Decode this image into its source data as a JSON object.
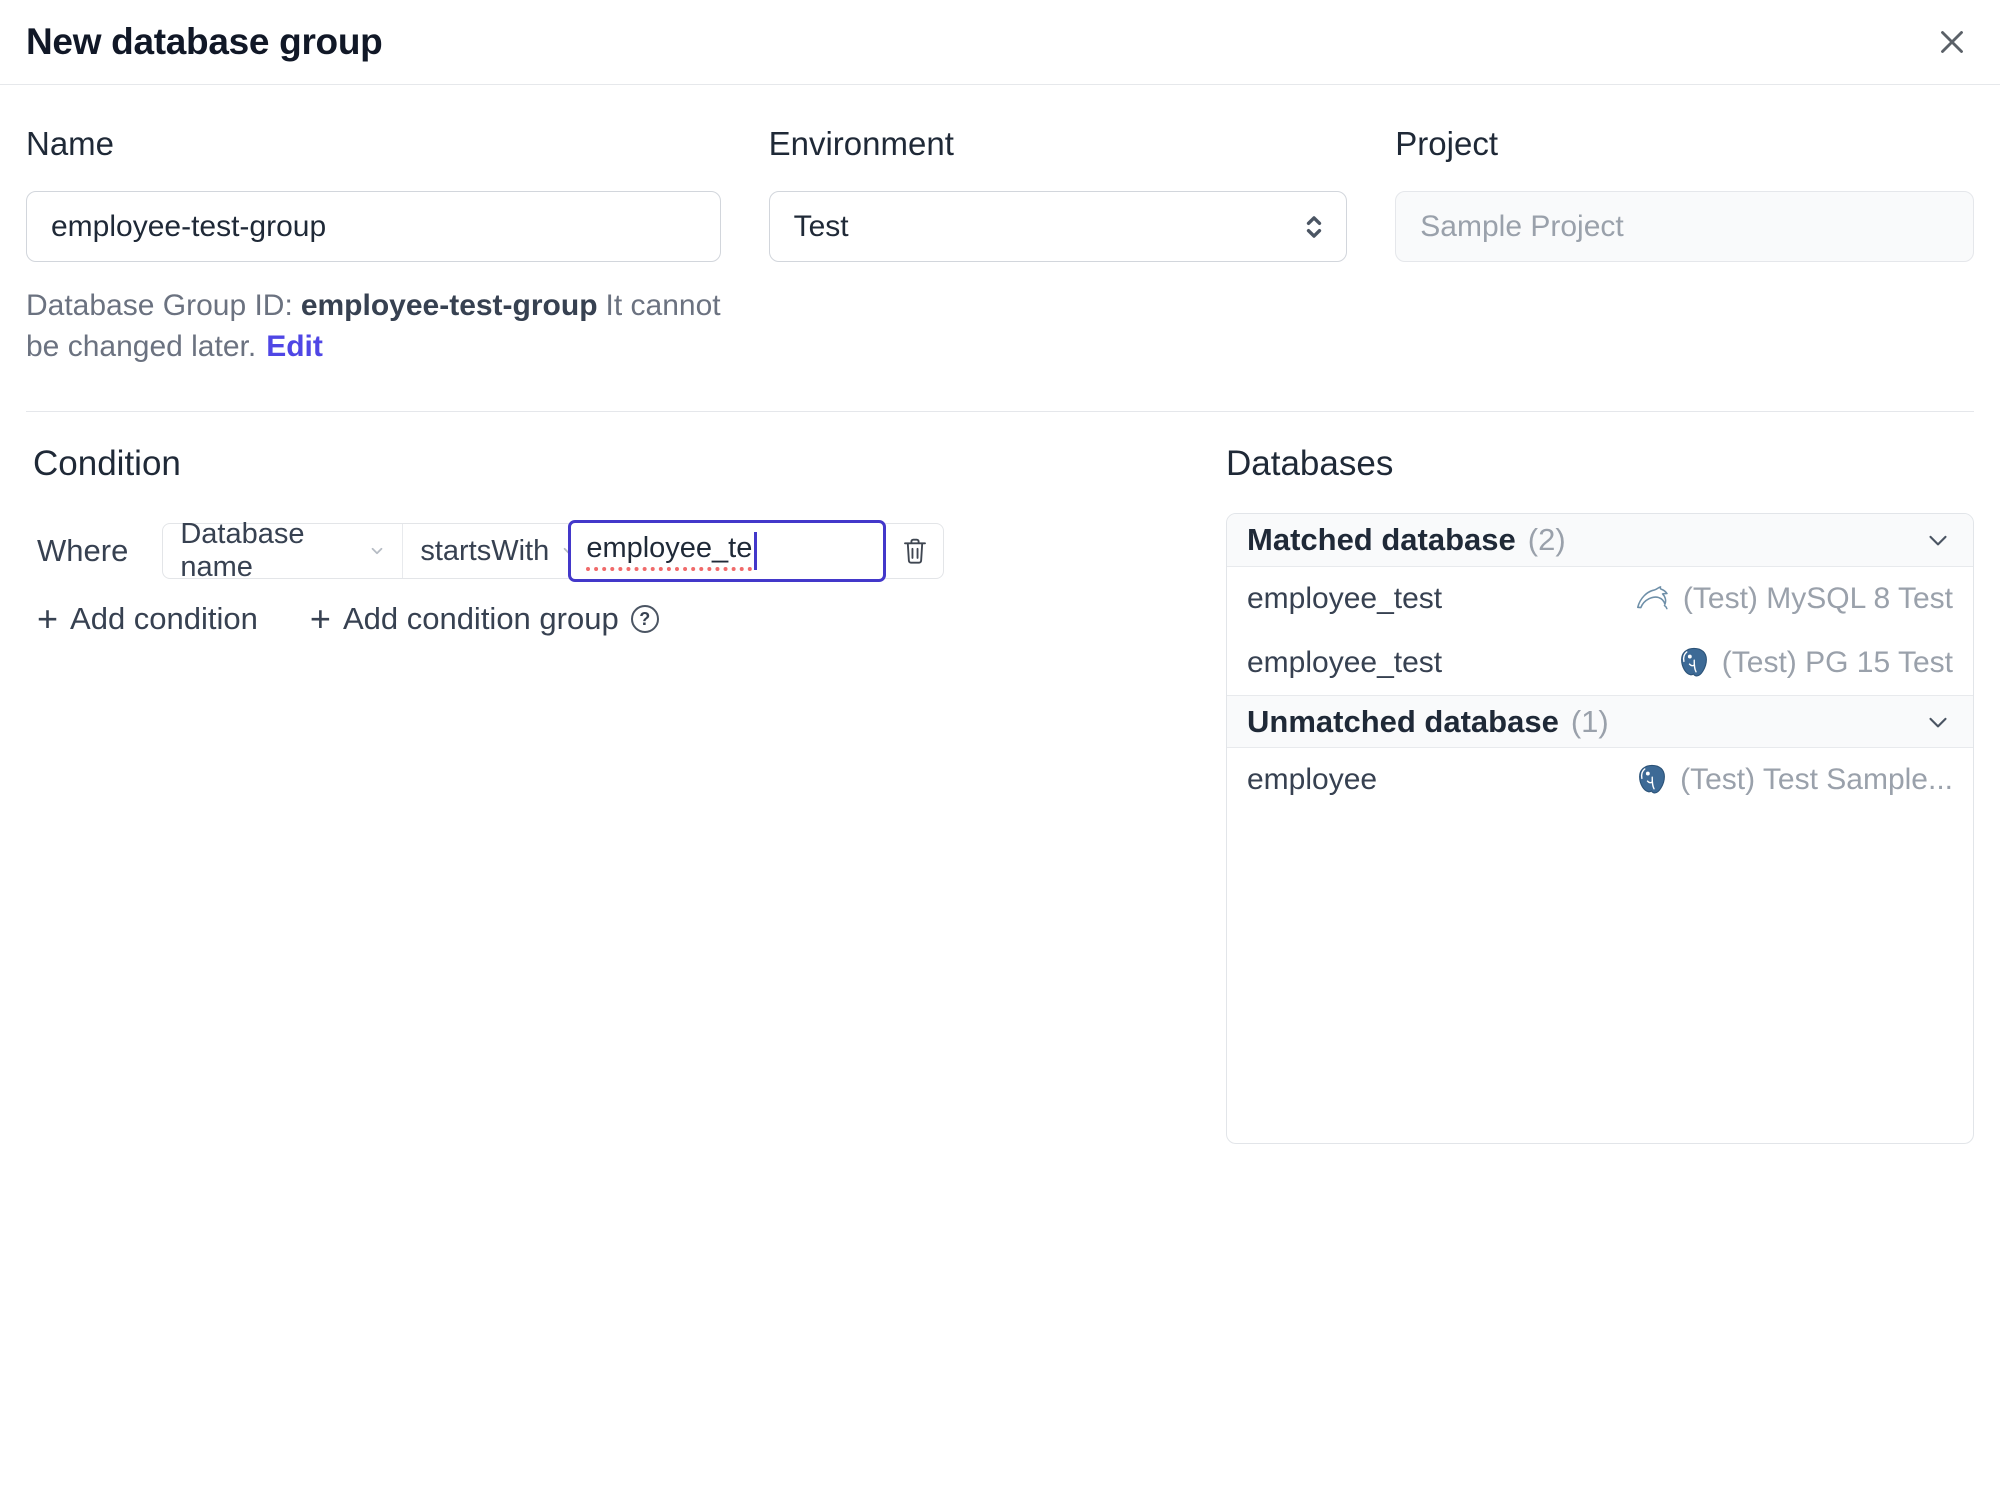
{
  "dialog": {
    "title": "New database group"
  },
  "form": {
    "name": {
      "label": "Name",
      "value": "employee-test-group"
    },
    "environment": {
      "label": "Environment",
      "value": "Test"
    },
    "project": {
      "label": "Project",
      "value": "Sample Project"
    },
    "group_id_note": {
      "prefix": "Database Group ID:",
      "id": "employee-test-group",
      "suffix_line1": "It cannot",
      "suffix_line2": "be changed later.",
      "edit": "Edit"
    }
  },
  "condition": {
    "heading": "Condition",
    "where": "Where",
    "factor": "Database name",
    "operator": "startsWith",
    "value": "employee_te",
    "plus": "+",
    "add_condition": "Add condition",
    "add_condition_group": "Add condition group",
    "help": "?"
  },
  "databases": {
    "heading": "Databases",
    "matched": {
      "title": "Matched database",
      "count": "(2)",
      "rows": [
        {
          "name": "employee_test",
          "engine": "mysql",
          "instance": "(Test) MySQL 8 Test"
        },
        {
          "name": "employee_test",
          "engine": "postgres",
          "instance": "(Test) PG 15 Test"
        }
      ]
    },
    "unmatched": {
      "title": "Unmatched database",
      "count": "(1)",
      "rows": [
        {
          "name": "employee",
          "engine": "postgres",
          "instance": "(Test) Test Sample..."
        }
      ]
    }
  },
  "colors": {
    "accent": "#4f46e5",
    "focus_border": "#4338ca",
    "spellcheck_red": "#f06a6a",
    "mysql_icon": "#6e8fa8",
    "postgres_icon": "#3d6a96",
    "panel_header_bg": "#f9fafb",
    "border": "#e5e7eb"
  }
}
